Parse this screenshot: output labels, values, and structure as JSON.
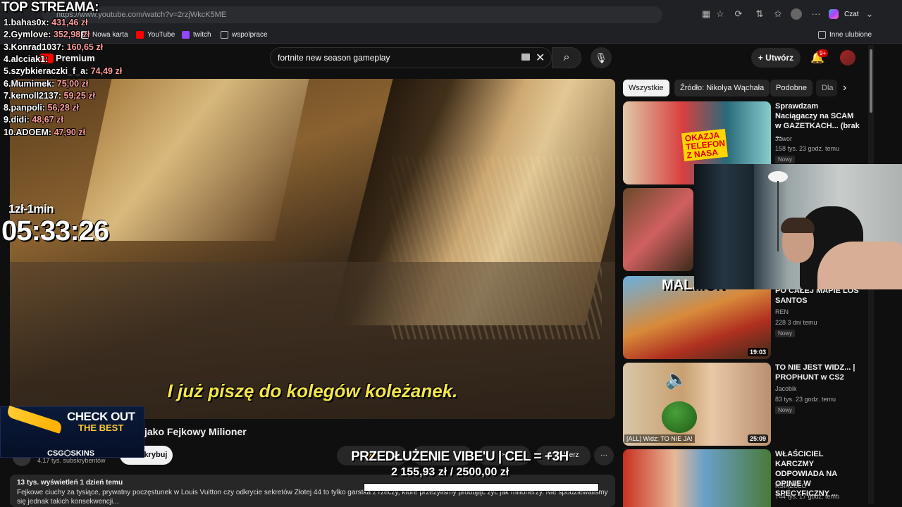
{
  "browser": {
    "url": "https://www.youtube.com/watch?v=2rzjWkcK5ME",
    "chat_label": "Czat",
    "other_favorites": "Inne ulubione",
    "bookmarks": [
      "Nowa karta",
      "YouTube",
      "twitch",
      "wspolprace"
    ]
  },
  "yt": {
    "logo": "Premium",
    "search_query": "fortnite new season gameplay",
    "create_label": "Utwórz",
    "notif_count": "9+"
  },
  "video": {
    "subtitle": "I już piszę do kolegów koleżanek.",
    "title": "jako Fejkowy Milioner",
    "channel_subs": "4,17 tys. subskrybentów",
    "subscribe": "Subskrybuj",
    "download": "Pobierz",
    "desc_stats": "13 tys. wyświetleń  1 dzień temu",
    "desc_text": "Fejkowe ciuchy za tysiące, prywatny poczęstunek w Louis Vuitton czy odkrycie sekretów Złotej 44 to tylko garstka z rzeczy, które przeżyliśmy próbując żyć jak milionerzy. Nie spodziewaliśmy się jednak takich konsekwencji..."
  },
  "sidebar": {
    "chips": [
      "Wszystkie",
      "Źródło: Nikolya Wąchała",
      "Podobne",
      "Dla"
    ],
    "recs": [
      {
        "title": "Sprawdzam Naciągaczy na SCAM w GAZETKACH... (brak ...",
        "channel": "Jawor",
        "meta": "158 tys.  23 godz. temu",
        "badge": "Nowy",
        "duration": "",
        "thumb_text": "OKAZJA TELEFON Z NASA"
      },
      {
        "title": "",
        "channel": "",
        "meta": "",
        "badge": "",
        "duration": "",
        "thumb_text": ""
      },
      {
        "title": "PO CAŁEJ MAPIE LOS SANTOS",
        "channel": "REN",
        "meta": "228  3 dni temu",
        "badge": "Nowy",
        "duration": "19:03",
        "thumb_text": "MAL...ON"
      },
      {
        "title": "TO NIE JEST WIDZ... | PROPHUNT w CS2",
        "channel": "Jacobik",
        "meta": "83 tys.  23 godz. temu",
        "badge": "Nowy",
        "duration": "25:09",
        "thumb_text": "[ALL] Widz: TO NIE JA!"
      },
      {
        "title": "WŁAŚCICIEL KARCZMY ODPOWIADA NA OPINIE W SPECYFICZNY ...",
        "channel": "KSIĄŻULO",
        "meta": "744 tys.  17 godz. temu",
        "badge": "",
        "duration": "",
        "thumb_text": ""
      }
    ]
  },
  "overlay": {
    "top_title": "TOP STREAMA:",
    "top": [
      {
        "rank": "1.",
        "name": "bahas0x:",
        "amount": "431,46 zł"
      },
      {
        "rank": "2.",
        "name": "Gymlove:",
        "amount": "352,98 zł"
      },
      {
        "rank": "3.",
        "name": "Konrad1037:",
        "amount": "160,65 zł"
      },
      {
        "rank": "4.",
        "name": "alcciak1:",
        "amount": ""
      },
      {
        "rank": "5.",
        "name": "szybkieraczki_f_a:",
        "amount": "74,49 zł"
      },
      {
        "rank": "6.",
        "name": "Mumimek:",
        "amount": "75,00 zł"
      },
      {
        "rank": "7.",
        "name": "kemoll2137:",
        "amount": "59,25 zł"
      },
      {
        "rank": "8.",
        "name": "panpoli:",
        "amount": "56,28 zł"
      },
      {
        "rank": "9.",
        "name": "didi:",
        "amount": "48,67 zł"
      },
      {
        "rank": "10.",
        "name": "ADOEM:",
        "amount": "47,90 zł"
      }
    ],
    "rate_label": "1zł-1min",
    "timer": "05:33:26",
    "ad_title": "CHECK OUT",
    "ad_sub": "THE BEST",
    "ad_brand": "CSG⬡SKINS",
    "goal_label": "PRZEDŁUŻENIE VIBE'U | CEL = +3H",
    "goal_amount": "2 155,93 zł  /  2500,00 zł",
    "goal_progress": 0.862
  }
}
